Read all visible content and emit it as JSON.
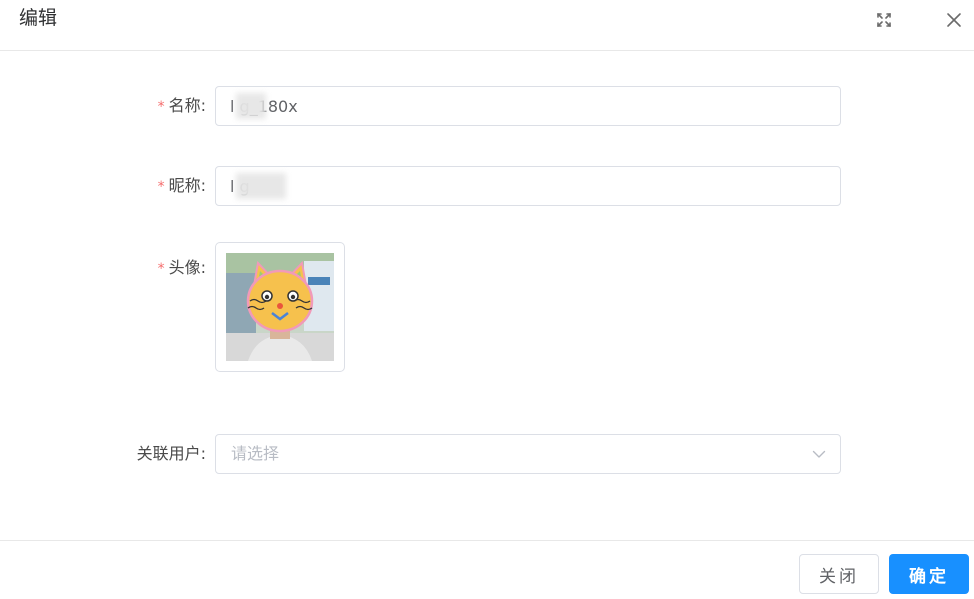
{
  "dialog": {
    "title": "编辑"
  },
  "form": {
    "name": {
      "label": "名称:",
      "required": true,
      "value": "l g_180x"
    },
    "nickname": {
      "label": "昵称:",
      "required": true,
      "value": "l g"
    },
    "avatar": {
      "label": "头像:",
      "required": true
    },
    "linked_user": {
      "label": "关联用户:",
      "placeholder": "请选择"
    }
  },
  "footer": {
    "close_label": "关闭",
    "confirm_label": "确定"
  },
  "colors": {
    "primary": "#1890ff",
    "required_star": "#f56c6c",
    "border": "#dcdfe6"
  },
  "icons": {
    "fullscreen": "fullscreen-icon",
    "close": "close-icon",
    "select_arrow": "chevron-down-icon"
  }
}
